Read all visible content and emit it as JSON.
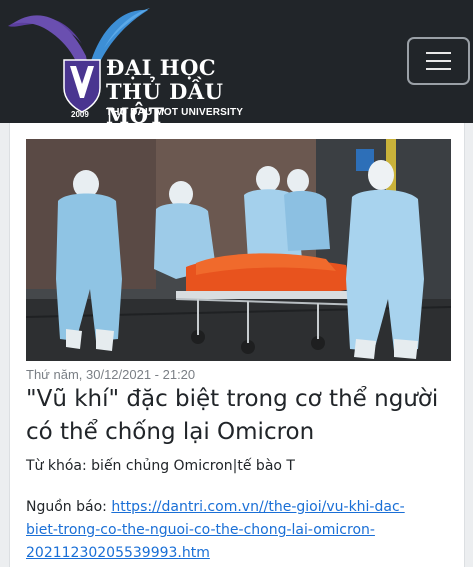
{
  "header": {
    "logo": {
      "line1": "ĐẠI HỌC",
      "line2": "THỦ DẦU MỘT",
      "subtitle": "THU DAU MOT UNIVERSITY",
      "year": "2009"
    },
    "menu_icon": "hamburger-icon"
  },
  "article": {
    "image_subject": "medical-workers-photo",
    "date": "Thứ năm, 30/12/2021 - 21:20",
    "title": "\"Vũ khí\" đặc biệt trong cơ thể người có thể chống lại Omicron",
    "keywords_label": "Từ khóa: biến chủng Omicron|tế bào T",
    "source_label": "Nguồn báo: ",
    "source_url": "https://dantri.com.vn//the-gioi/vu-khi-dac-biet-trong-co-the-nguoi-co-the-chong-lai-omicron-20211230205539993.htm",
    "source_link_lines": [
      "https://dantri.com.vn//the-gioi/vu-khi-dac-",
      "biet-trong-co-the-nguoi-co-the-chong-lai-omicron-",
      "20211230205539993.htm"
    ]
  },
  "colors": {
    "header_bg": "#212529",
    "link": "#1a6fd6",
    "logo_purple": "#5b3f9e",
    "logo_blue": "#3d8fd6"
  }
}
